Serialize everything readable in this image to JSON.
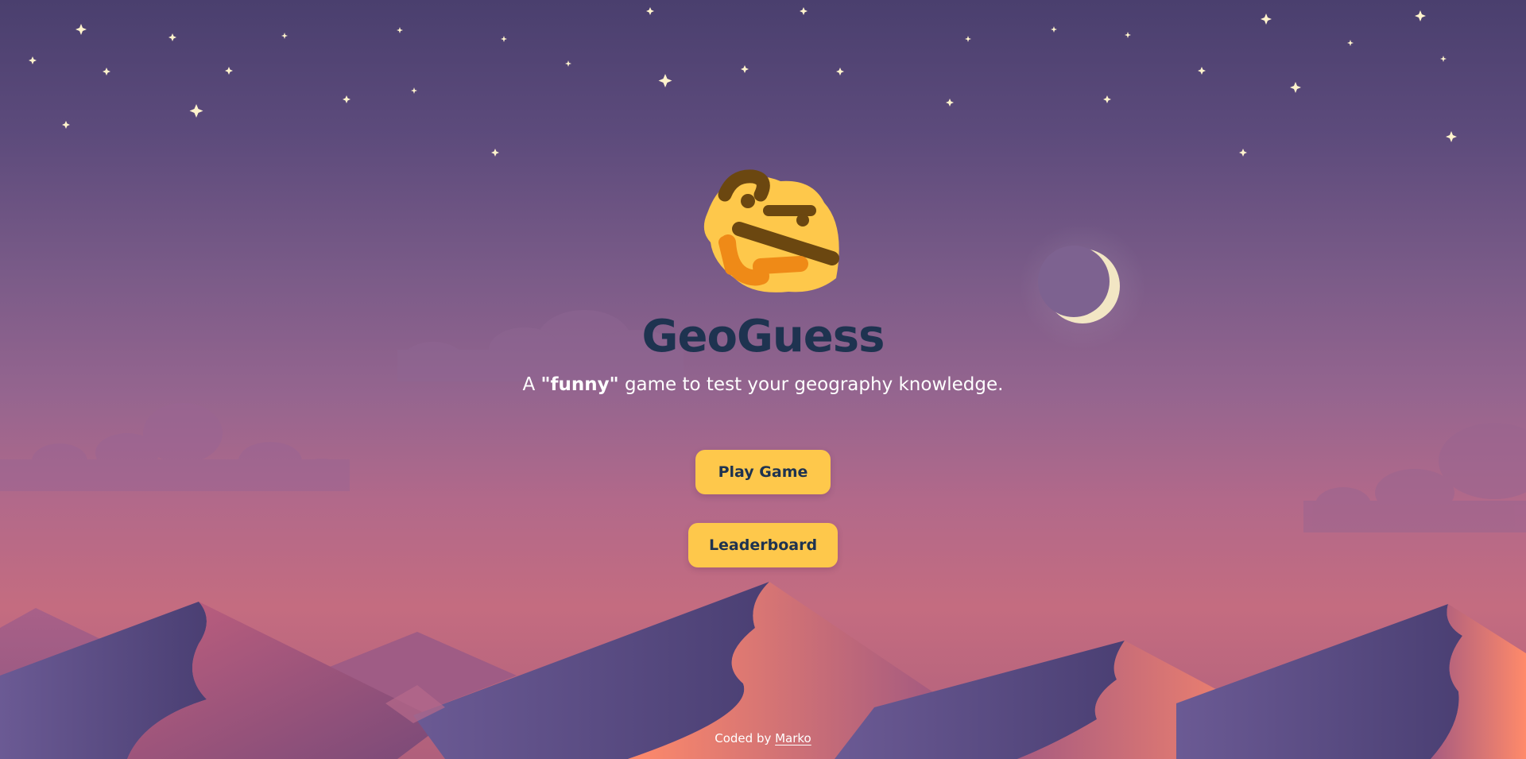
{
  "app": {
    "title": "GeoGuess",
    "subtitle_prefix": "A ",
    "subtitle_emphasis": "\"funny\"",
    "subtitle_suffix": " game to test your geography knowledge."
  },
  "menu": {
    "play_label": "Play Game",
    "leaderboard_label": "Leaderboard"
  },
  "footer": {
    "credit_prefix": "Coded by ",
    "author_link": "Marko"
  },
  "scene": {
    "logo_icon": "thinking-face-icon",
    "moon_icon": "crescent-moon-icon",
    "colors": {
      "button": "#fec84b",
      "title": "#1e3350",
      "moon": "#f2e6c4",
      "star": "#fff3cc"
    }
  }
}
